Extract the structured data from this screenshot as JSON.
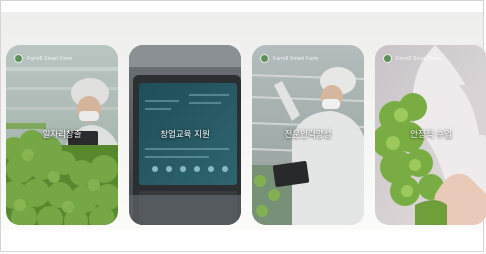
{
  "cards": [
    {
      "label": "일자리창출",
      "brand": "Farm8 Smart Farm"
    },
    {
      "label": "창업교육 지원",
      "brand": ""
    },
    {
      "label": "전문인력양성",
      "brand": "Farm8 Smart Farm"
    },
    {
      "label": "안정적 수입",
      "brand": "Farm8 Smart Farm"
    }
  ],
  "colors": {
    "badge_green": "#5e8f58",
    "lettuce_green": "#6fa23f",
    "screen_teal": "#2a5a62"
  }
}
